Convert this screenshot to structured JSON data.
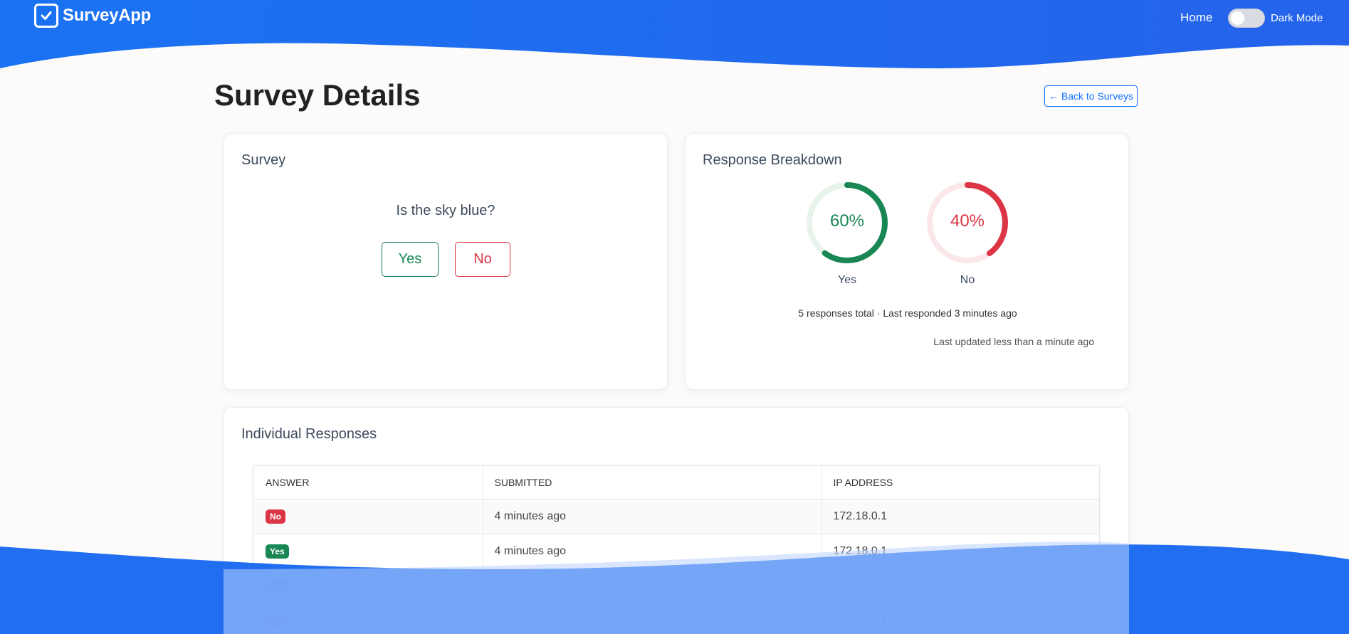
{
  "navbar": {
    "brand": "SurveyApp",
    "home": "Home",
    "dark_mode_label": "Dark Mode"
  },
  "page": {
    "title": "Survey Details",
    "back_button": "← Back to Surveys"
  },
  "survey_card": {
    "title": "Survey",
    "question": "Is the sky blue?",
    "yes_label": "Yes",
    "no_label": "No"
  },
  "breakdown": {
    "title": "Response Breakdown",
    "yes": {
      "label": "Yes",
      "percent_text": "60%",
      "fraction": 0.6,
      "color": "#198754",
      "track": "#e8f3ec"
    },
    "no": {
      "label": "No",
      "percent_text": "40%",
      "fraction": 0.4,
      "color": "#dc3545",
      "track": "#fbe7e9"
    },
    "summary": "5 responses total · Last responded 3 minutes ago",
    "updated": "Last updated less than a minute ago"
  },
  "responses": {
    "title": "Individual Responses",
    "headers": [
      "ANSWER",
      "SUBMITTED",
      "IP ADDRESS"
    ],
    "rows": [
      {
        "answer": "No",
        "submitted": "4 minutes ago",
        "ip": "172.18.0.1"
      },
      {
        "answer": "Yes",
        "submitted": "4 minutes ago",
        "ip": "172.18.0.1"
      },
      {
        "answer": "Yes",
        "submitted": "4 minutes ago",
        "ip": "172.18.0.1"
      },
      {
        "answer": "No",
        "submitted": "4 minutes ago",
        "ip": "172.18.0.1"
      }
    ]
  },
  "colors": {
    "brand_blue": "#1a6af0",
    "success": "#198754",
    "danger": "#dc3545"
  }
}
